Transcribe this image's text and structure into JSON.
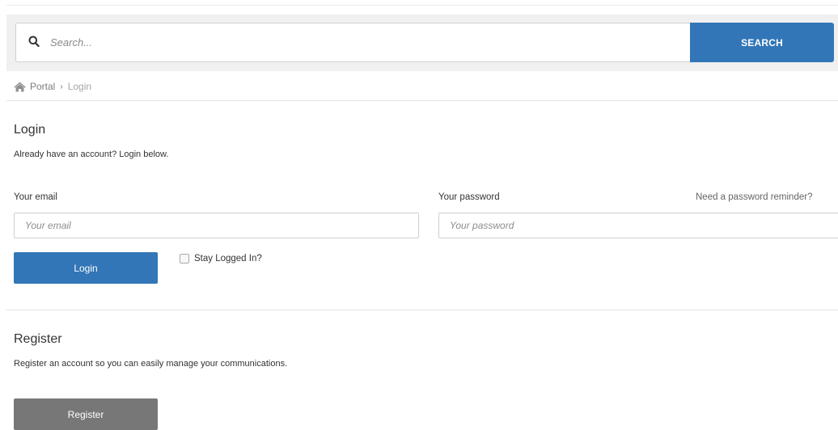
{
  "search": {
    "placeholder": "Search...",
    "button_label": "SEARCH"
  },
  "breadcrumb": {
    "home_label": "Portal",
    "separator": "›",
    "current": "Login"
  },
  "login": {
    "title": "Login",
    "description": "Already have an account? Login below.",
    "email_label": "Your email",
    "email_placeholder": "Your email",
    "password_label": "Your password",
    "password_placeholder": "Your password",
    "reminder_link": "Need a password reminder?",
    "button_label": "Login",
    "stay_logged_in_label": "Stay Logged In?",
    "stay_logged_in_checked": false
  },
  "register": {
    "title": "Register",
    "description": "Register an account so you can easily manage your communications.",
    "button_label": "Register"
  },
  "colors": {
    "primary": "#3276b8",
    "secondary_button": "#777777",
    "search_band": "#f0f0f0"
  },
  "icons": [
    "search-icon",
    "home-icon",
    "chevron-right-icon"
  ]
}
